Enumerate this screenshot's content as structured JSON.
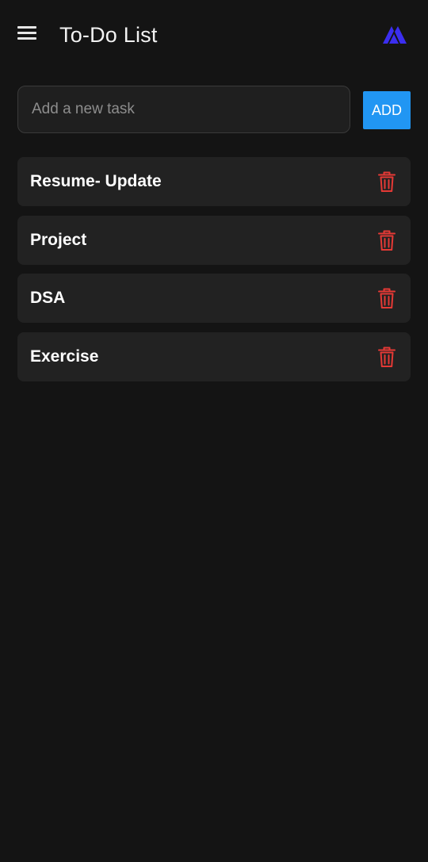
{
  "header": {
    "title": "To-Do List",
    "menu_icon": "hamburger-menu-icon",
    "logo_icon": "mountain-logo-icon"
  },
  "new_task": {
    "placeholder": "Add a new task",
    "value": "",
    "add_label": "ADD"
  },
  "tasks": [
    {
      "text": "Resume- Update",
      "delete_icon": "trash-icon"
    },
    {
      "text": "Project",
      "delete_icon": "trash-icon"
    },
    {
      "text": "DSA",
      "delete_icon": "trash-icon"
    },
    {
      "text": "Exercise",
      "delete_icon": "trash-icon"
    }
  ],
  "colors": {
    "background": "#141414",
    "card": "#222222",
    "accent": "#2196f3",
    "delete": "#e53935",
    "logo": "#3b2ef0"
  }
}
